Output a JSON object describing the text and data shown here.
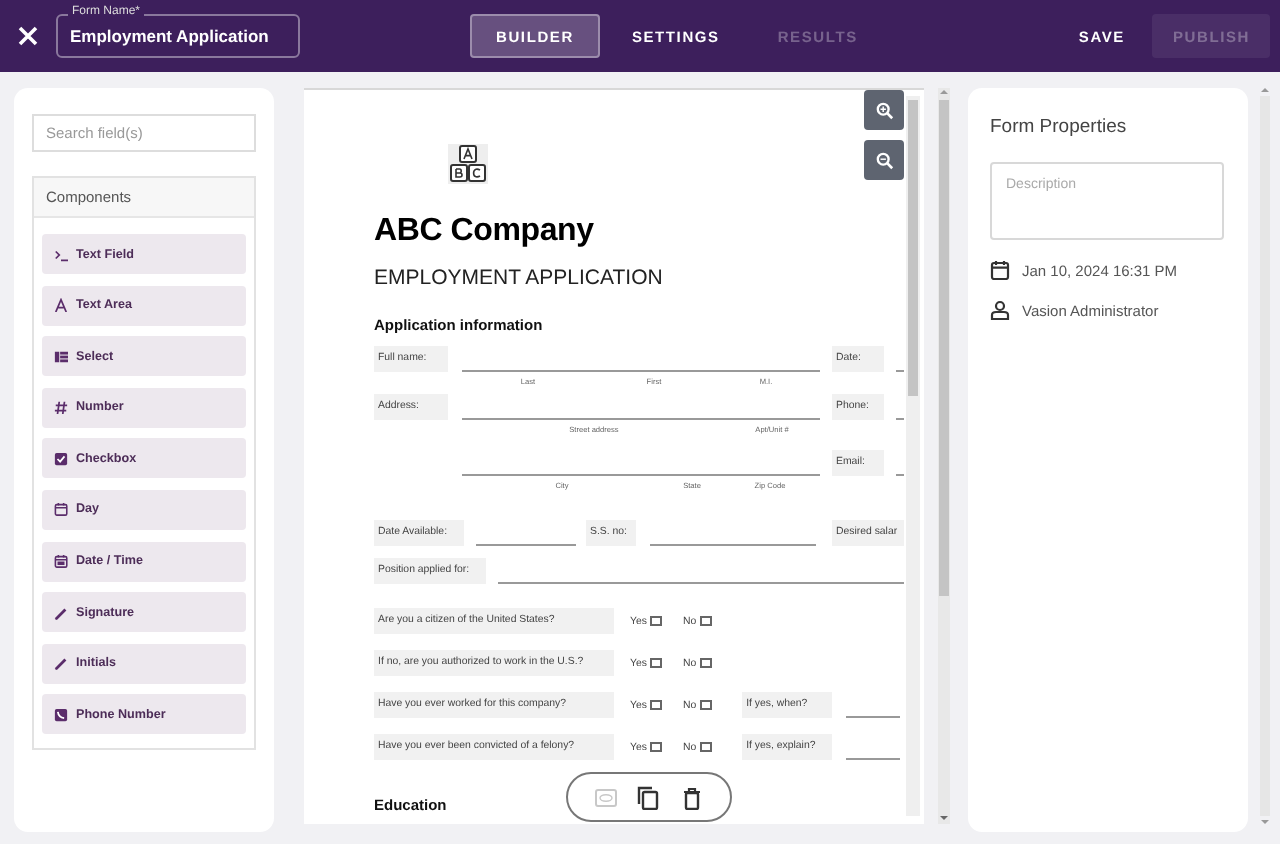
{
  "header": {
    "form_name": {
      "label": "Form Name*",
      "value": "Employment Application"
    },
    "tabs": [
      {
        "label": "BUILDER",
        "selected": true,
        "disabled": false
      },
      {
        "label": "SETTINGS",
        "selected": false,
        "disabled": false
      },
      {
        "label": "RESULTS",
        "selected": false,
        "disabled": true
      }
    ],
    "actions": [
      {
        "label": "SAVE",
        "disabled": false
      },
      {
        "label": "PUBLISH",
        "disabled": true
      }
    ]
  },
  "sidebar": {
    "search": {
      "placeholder": "Search field(s)"
    },
    "title": "Components",
    "items": [
      {
        "label": "Text Field",
        "kind": "text_field"
      },
      {
        "label": "Text Area",
        "kind": "text_area"
      },
      {
        "label": "Select",
        "kind": "select"
      },
      {
        "label": "Number",
        "kind": "number"
      },
      {
        "label": "Checkbox",
        "kind": "checkbox"
      },
      {
        "label": "Day",
        "kind": "day"
      },
      {
        "label": "Date / Time",
        "kind": "datetime"
      },
      {
        "label": "Signature",
        "kind": "signature"
      },
      {
        "label": "Initials",
        "kind": "initials"
      },
      {
        "label": "Phone Number",
        "kind": "phone"
      }
    ]
  },
  "document": {
    "company": "ABC Company",
    "title": "EMPLOYMENT APPLICATION",
    "section": "Application information",
    "name_row": {
      "label": "Full name:",
      "sublabels": [
        "Last",
        "First",
        "M.I."
      ],
      "side_label": "Date:"
    },
    "address_row": {
      "label": "Address:",
      "sublabels": [
        "Street address",
        "Apt/Unit #"
      ],
      "side_label": "Phone:"
    },
    "city_row": {
      "sublabels": [
        "City",
        "State",
        "Zip Code"
      ],
      "side_label": "Email:"
    },
    "detail_row": {
      "labels": [
        "Date Available:",
        "S.S. no:",
        "Desired salar"
      ]
    },
    "position_row": {
      "label": "Position applied for:"
    },
    "questions": [
      {
        "text": "Are you a citizen of the United States?",
        "yes": "Yes",
        "no": "No"
      },
      {
        "text": "If no, are you authorized to work in the U.S.?",
        "yes": "Yes",
        "no": "No"
      },
      {
        "text": "Have you ever worked for this company?",
        "yes": "Yes",
        "no": "No",
        "follow_up": "If yes, when?"
      },
      {
        "text": "Have you ever been convicted of a felony?",
        "yes": "Yes",
        "no": "No",
        "follow_up": "If yes, explain?"
      }
    ],
    "next_section": "Education"
  },
  "floating_toolbar": [
    {
      "kind": "preview",
      "disabled": true
    },
    {
      "kind": "copy",
      "disabled": false
    },
    {
      "kind": "delete",
      "disabled": false
    }
  ],
  "properties": {
    "title": "Form Properties",
    "description": {
      "placeholder": "Description"
    },
    "created": "Jan 10, 2024 16:31 PM",
    "owner": "Vasion Administrator"
  }
}
